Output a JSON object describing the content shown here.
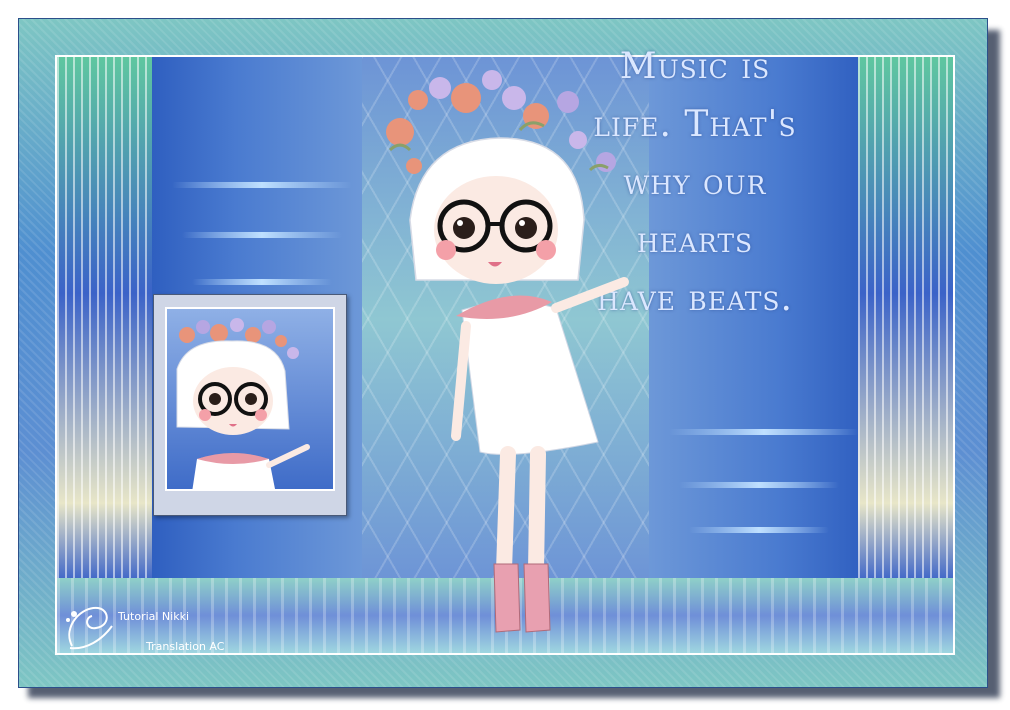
{
  "quote": {
    "line1": "Music is",
    "line2": "life. That's",
    "line3": "why our",
    "line4": "hearts",
    "line5": "have beats."
  },
  "watermark": {
    "line1": "Tutorial Nikki",
    "line2": "Translation AC"
  },
  "colors": {
    "frame": "#4f8fd0",
    "teal": "#63c2a8",
    "quote_text": "#dbe7ff",
    "dress": "#ffffff",
    "ruffle": "#e89aa6",
    "boots": "#e8a0b0"
  },
  "icons": [
    "flower-crown-icon",
    "flourish-icon"
  ]
}
